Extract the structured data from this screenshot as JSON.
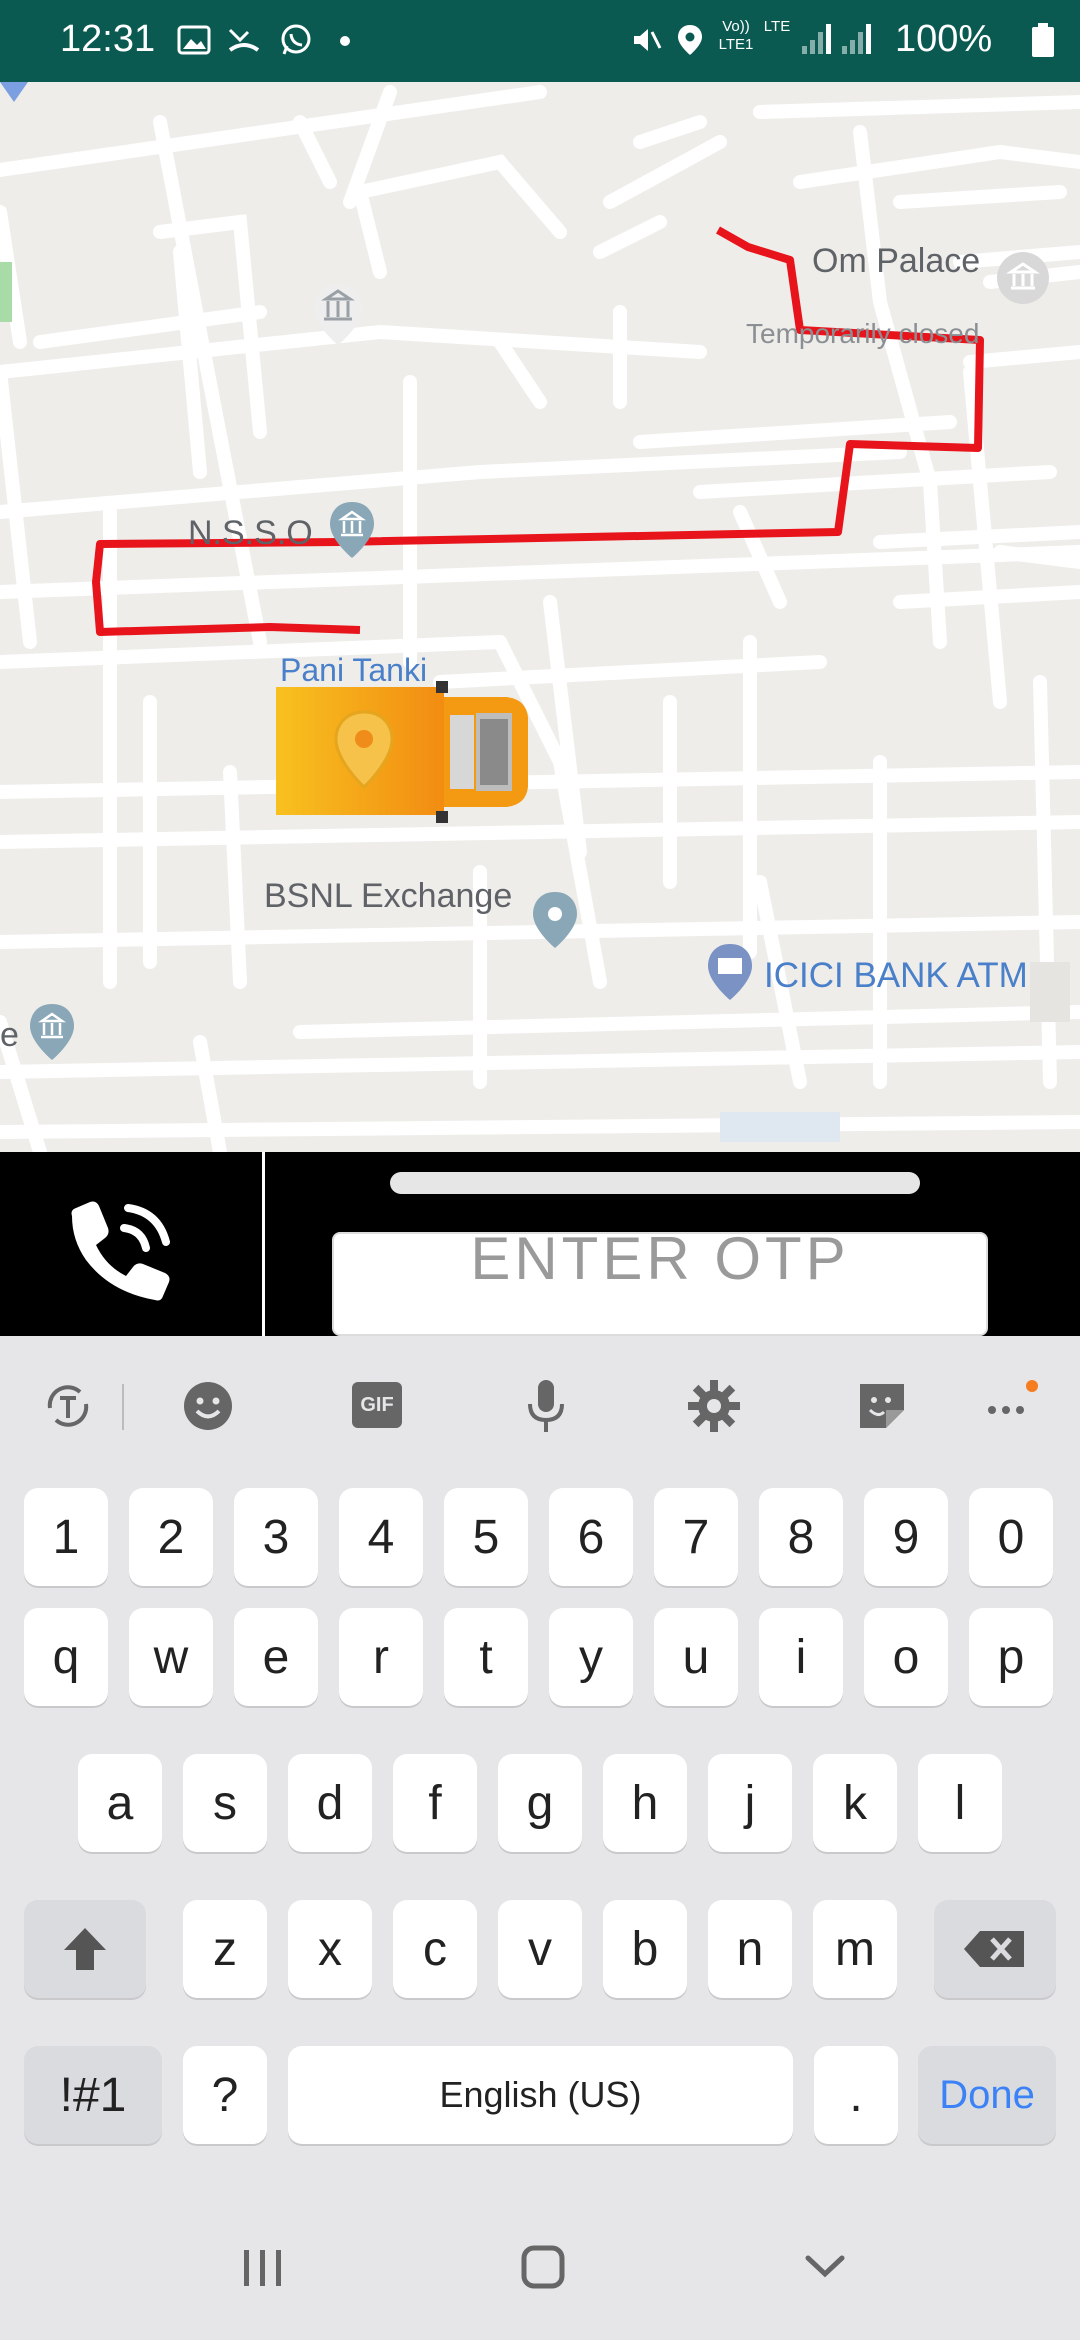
{
  "status_bar": {
    "time": "12:31",
    "battery": "100%",
    "volte": "Vo)) LTE1",
    "lte": "LTE",
    "icons": [
      "gallery-icon",
      "missed-call-icon",
      "whatsapp-icon",
      "dot-icon",
      "mute-icon",
      "location-icon",
      "signal-icon",
      "battery-icon"
    ]
  },
  "map": {
    "labels": {
      "om_palace": "Om Palace",
      "temporarily_closed": "Temporarily closed",
      "nsso": "N.S.S.O",
      "pani_tanki": "Pani Tanki",
      "bsnl": "BSNL Exchange",
      "icici": "ICICI BANK ATM",
      "edge_e": "e"
    },
    "route_color": "#e8141b"
  },
  "action_bar": {
    "otp_placeholder": "ENTER OTP"
  },
  "keyboard": {
    "toolbar": [
      "text-translate-icon",
      "emoji-icon",
      "gif-icon",
      "microphone-icon",
      "settings-icon",
      "sticker-icon",
      "more-icon"
    ],
    "gif_label": "GIF",
    "row_numbers": [
      "1",
      "2",
      "3",
      "4",
      "5",
      "6",
      "7",
      "8",
      "9",
      "0"
    ],
    "row1": [
      "q",
      "w",
      "e",
      "r",
      "t",
      "y",
      "u",
      "i",
      "o",
      "p"
    ],
    "row2": [
      "a",
      "s",
      "d",
      "f",
      "g",
      "h",
      "j",
      "k",
      "l"
    ],
    "row3": [
      "z",
      "x",
      "c",
      "v",
      "b",
      "n",
      "m"
    ],
    "symbols_label": "!#1",
    "question_label": "?",
    "space_label": "English (US)",
    "period_label": ".",
    "done_label": "Done"
  },
  "navbar": {
    "buttons": [
      "recent-apps-icon",
      "home-icon",
      "back-icon"
    ]
  }
}
